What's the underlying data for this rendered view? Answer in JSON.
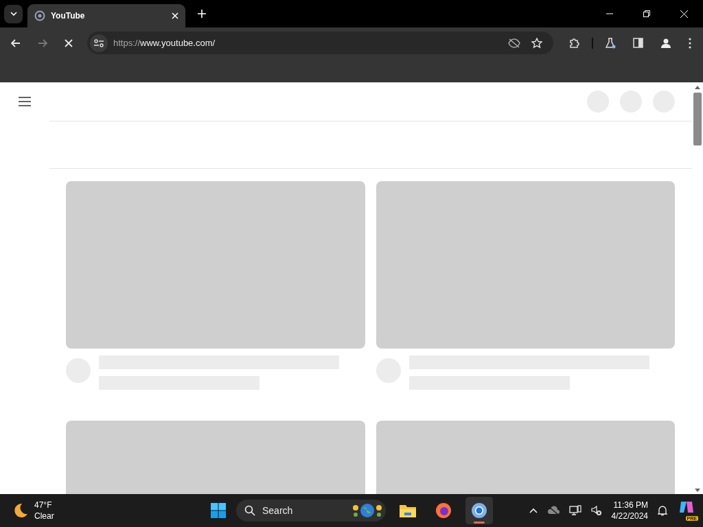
{
  "tab": {
    "title": "YouTube",
    "selected": true
  },
  "toolbar": {
    "loading": true,
    "url_scheme": "https://",
    "url_host": "www.youtube.com/"
  },
  "taskbar": {
    "weather": {
      "temp": "47°F",
      "condition": "Clear"
    },
    "search": {
      "placeholder": "Search"
    },
    "apps": [
      {
        "kind": "files",
        "selected": false
      },
      {
        "kind": "firefox",
        "selected": false
      },
      {
        "kind": "chrome",
        "selected": true
      }
    ],
    "time": "11:36 PM",
    "date": "4/22/2024",
    "copilot_badge": "PRE"
  }
}
